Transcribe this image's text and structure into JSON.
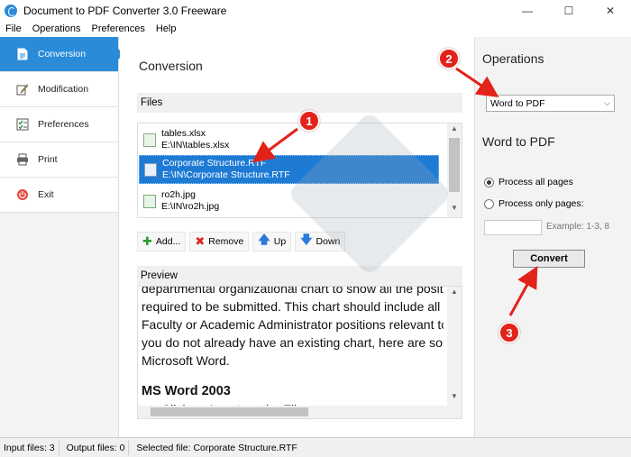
{
  "window": {
    "title": "Document to PDF Converter 3.0 Freeware",
    "minimize": "—",
    "maximize": "☐",
    "close": "✕"
  },
  "menu": [
    "File",
    "Operations",
    "Preferences",
    "Help"
  ],
  "nav": [
    {
      "label": "Conversion",
      "icon": "document-icon"
    },
    {
      "label": "Modification",
      "icon": "edit-icon"
    },
    {
      "label": "Preferences",
      "icon": "checklist-icon"
    },
    {
      "label": "Print",
      "icon": "printer-icon"
    },
    {
      "label": "Exit",
      "icon": "power-icon"
    }
  ],
  "main": {
    "title": "Conversion",
    "files_header": "Files",
    "files": [
      {
        "name": "tables.xlsx",
        "path": "E:\\IN\\tables.xlsx",
        "selected": false
      },
      {
        "name": "Corporate Structure.RTF",
        "path": "E:\\IN\\Corporate Structure.RTF",
        "selected": true
      },
      {
        "name": "ro2h.jpg",
        "path": "E:\\IN\\ro2h.jpg",
        "selected": false
      }
    ],
    "toolbar": {
      "add": "Add...",
      "remove": "Remove",
      "up": "Up",
      "down": "Down"
    },
    "preview_header": "Preview",
    "preview_lines": [
      "departmental organizational chart to show all the positio",
      "required to be submitted. This chart should include all P",
      "Faculty or Academic Administrator positions relevant to",
      "you do not already have an existing chart, here are some",
      "Microsoft Word."
    ],
    "preview_heading": "MS Word 2003",
    "preview_next": "Click on Insert on the File"
  },
  "operations": {
    "title": "Operations",
    "selected": "Word to PDF",
    "subtitle": "Word to PDF",
    "radio_all": "Process all pages",
    "radio_only": "Process only pages:",
    "pages_hint": "Example: 1-3, 8",
    "convert": "Convert"
  },
  "status": {
    "input_files": "Input files: 3",
    "output_files": "Output files: 0",
    "selected_file": "Selected file: Corporate Structure.RTF"
  },
  "badges": [
    "1",
    "2",
    "3"
  ],
  "colors": {
    "accent": "#2a8bd8",
    "selection": "#1e7bd4",
    "annotation": "#e2231a"
  }
}
